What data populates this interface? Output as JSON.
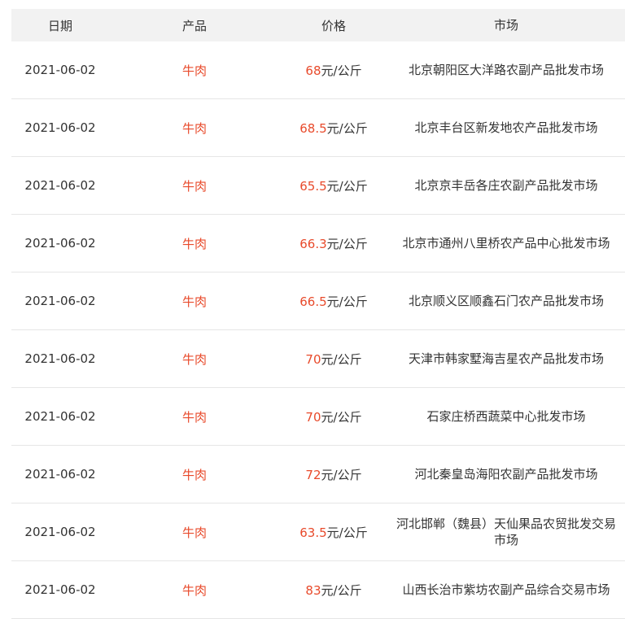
{
  "header": {
    "date": "日期",
    "product": "产品",
    "price": "价格",
    "market": "市场"
  },
  "rows": [
    {
      "date": "2021-06-02",
      "product": "牛肉",
      "price": "68",
      "unit": "元/公斤",
      "market": "北京朝阳区大洋路农副产品批发市场"
    },
    {
      "date": "2021-06-02",
      "product": "牛肉",
      "price": "68.5",
      "unit": "元/公斤",
      "market": "北京丰台区新发地农产品批发市场"
    },
    {
      "date": "2021-06-02",
      "product": "牛肉",
      "price": "65.5",
      "unit": "元/公斤",
      "market": "北京京丰岳各庄农副产品批发市场"
    },
    {
      "date": "2021-06-02",
      "product": "牛肉",
      "price": "66.3",
      "unit": "元/公斤",
      "market": "北京市通州八里桥农产品中心批发市场"
    },
    {
      "date": "2021-06-02",
      "product": "牛肉",
      "price": "66.5",
      "unit": "元/公斤",
      "market": "北京顺义区顺鑫石门农产品批发市场"
    },
    {
      "date": "2021-06-02",
      "product": "牛肉",
      "price": "70",
      "unit": "元/公斤",
      "market": "天津市韩家墅海吉星农产品批发市场"
    },
    {
      "date": "2021-06-02",
      "product": "牛肉",
      "price": "70",
      "unit": "元/公斤",
      "market": "石家庄桥西蔬菜中心批发市场"
    },
    {
      "date": "2021-06-02",
      "product": "牛肉",
      "price": "72",
      "unit": "元/公斤",
      "market": "河北秦皇岛海阳农副产品批发市场"
    },
    {
      "date": "2021-06-02",
      "product": "牛肉",
      "price": "63.5",
      "unit": "元/公斤",
      "market": "河北邯郸（魏县）天仙果品农贸批发交易市场"
    },
    {
      "date": "2021-06-02",
      "product": "牛肉",
      "price": "83",
      "unit": "元/公斤",
      "market": "山西长治市紫坊农副产品综合交易市场"
    }
  ]
}
